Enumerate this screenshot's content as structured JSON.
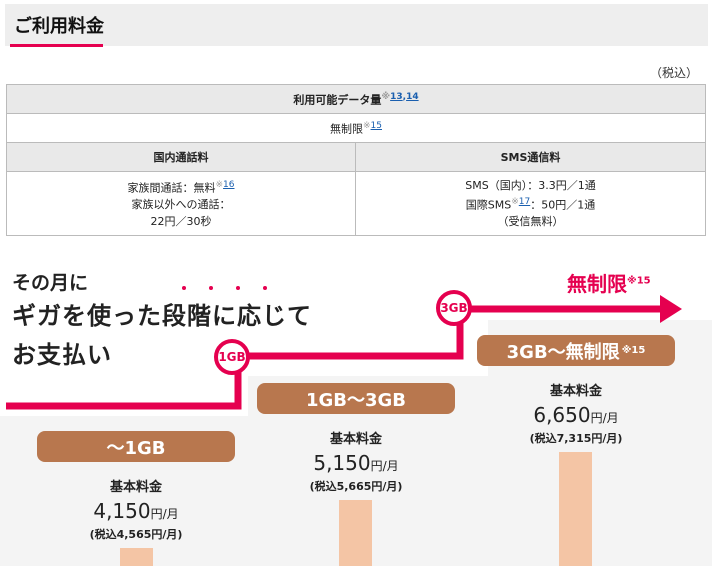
{
  "header": {
    "title": "ご利用料金"
  },
  "tax_note": "（税込）",
  "table": {
    "data_header": "利用可能データ量",
    "data_header_note": "※",
    "data_header_refs": [
      "13",
      "14"
    ],
    "data_value": "無制限",
    "data_value_note": "※",
    "data_value_ref": "15",
    "domestic_call_header": "国内通話料",
    "sms_header": "SMS通信料",
    "domestic_call_line1": "家族間通話：無料",
    "domestic_call_line1_note": "※",
    "domestic_call_line1_ref": "16",
    "domestic_call_line2": "家族以外への通話：",
    "domestic_call_line3": "22円／30秒",
    "sms_line1": "SMS（国内）：3.3円／1通",
    "sms_line2_prefix": "国際SMS",
    "sms_line2_note": "※",
    "sms_line2_ref": "17",
    "sms_line2_suffix": "：50円／1通",
    "sms_line3": "（受信無料）"
  },
  "intro": {
    "line1": "その月に",
    "line2": "ギガを使った段階に応じて",
    "line3": "お支払い"
  },
  "steps": {
    "step1": "1GB",
    "step2": "3GB",
    "unlimited_label": "無制限",
    "unlimited_note": "※15"
  },
  "plans": [
    {
      "name": "〜1GB",
      "name_note": "",
      "label": "基本料金",
      "price": "4,150",
      "unit": "円/月",
      "incl": "(税込4,565円/月)"
    },
    {
      "name": "1GB〜3GB",
      "name_note": "",
      "label": "基本料金",
      "price": "5,150",
      "unit": "円/月",
      "incl": "(税込5,665円/月)"
    },
    {
      "name": "3GB〜無制限",
      "name_note": "※15",
      "label": "基本料金",
      "price": "6,650",
      "unit": "円/月",
      "incl": "(税込7,315円/月)"
    }
  ],
  "colors": {
    "accent": "#e5004f",
    "pill": "#b8774e",
    "bar": "#f4c5a5",
    "panel": "#f4f4f4"
  }
}
